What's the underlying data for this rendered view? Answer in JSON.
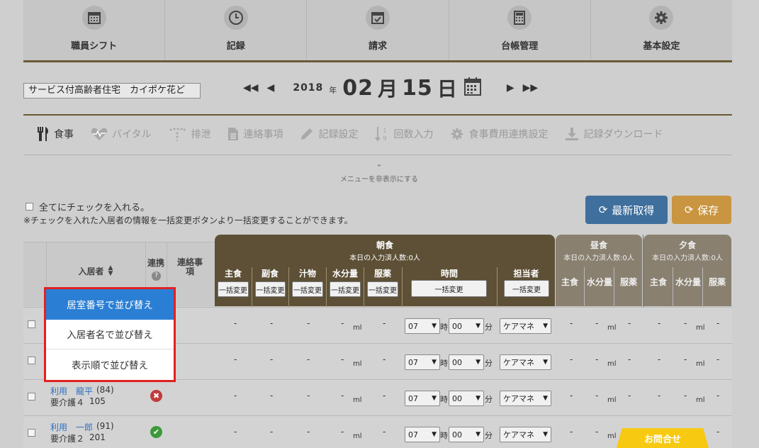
{
  "nav": [
    {
      "label": "職員シフト",
      "icon": "calendar-grid-icon"
    },
    {
      "label": "記録",
      "icon": "clock-icon"
    },
    {
      "label": "請求",
      "icon": "calendar-check-icon"
    },
    {
      "label": "台帳管理",
      "icon": "calculator-icon"
    },
    {
      "label": "基本設定",
      "icon": "gear-icon"
    }
  ],
  "facility": "サービス付高齢者住宅　カイポケ花ど",
  "date": {
    "year": "2018",
    "year_unit": "年",
    "month": "02",
    "month_unit": "月",
    "day": "15",
    "day_unit": "日"
  },
  "record_menu": [
    {
      "label": "食事",
      "icon": "fork-knife-icon",
      "active": true
    },
    {
      "label": "バイタル",
      "icon": "heartbeat-icon"
    },
    {
      "label": "排泄",
      "icon": "toilet-icon"
    },
    {
      "label": "連絡事項",
      "icon": "document-icon"
    },
    {
      "label": "記録設定",
      "icon": "pencil-icon"
    },
    {
      "label": "回数入力",
      "icon": "sort-number-icon"
    },
    {
      "label": "食事費用連携設定",
      "icon": "gear-icon"
    },
    {
      "label": "記録ダウンロード",
      "icon": "download-icon"
    }
  ],
  "hide_menu": "メニューを非表示にする",
  "check_all": "全てにチェックを入れる。",
  "note": "※チェックを入れた入居者の情報を一括変更ボタンより一括変更することができます。",
  "buttons": {
    "refresh": "最新取得",
    "save": "保存"
  },
  "table": {
    "resident_header": "入居者",
    "link_header": "連携",
    "contact_header": "連絡事項",
    "breakfast": {
      "title": "朝食",
      "sub": "本日の入力済人数:0人"
    },
    "lunch": {
      "title": "昼食",
      "sub": "本日の入力済人数:0人"
    },
    "dinner": {
      "title": "夕食",
      "sub": "本日の入力済人数:0人"
    },
    "cols": {
      "main": "主食",
      "side": "副食",
      "soup": "汁物",
      "water": "水分量",
      "medicine": "服薬",
      "time": "時間",
      "staff": "担当者"
    },
    "bulk_label": "一括変更",
    "dash": "-",
    "ml": "ml",
    "hour": "07",
    "hour_unit": "時",
    "minute": "00",
    "minute_unit": "分",
    "staff_value": "ケアマネ",
    "rows": [
      {
        "name": "",
        "age": "",
        "care": "",
        "room": "",
        "status": ""
      },
      {
        "name": "",
        "age": "",
        "care": "",
        "room": "",
        "status": ""
      },
      {
        "name": "利用　龍平",
        "age": "(84)",
        "care": "要介護４",
        "room": "105",
        "status": "x"
      },
      {
        "name": "利用　一郎",
        "age": "(91)",
        "care": "要介護２",
        "room": "201",
        "status": "check"
      }
    ]
  },
  "sort_menu": [
    "居室番号で並び替え",
    "入居者名で並び替え",
    "表示順で並び替え"
  ],
  "inquiry": "お問合せ",
  "colors": {
    "brown": "#5d5036",
    "blue": "#2a7fd4",
    "red": "#e12121",
    "refresh": "#3f6f9c",
    "save": "#c99540"
  }
}
